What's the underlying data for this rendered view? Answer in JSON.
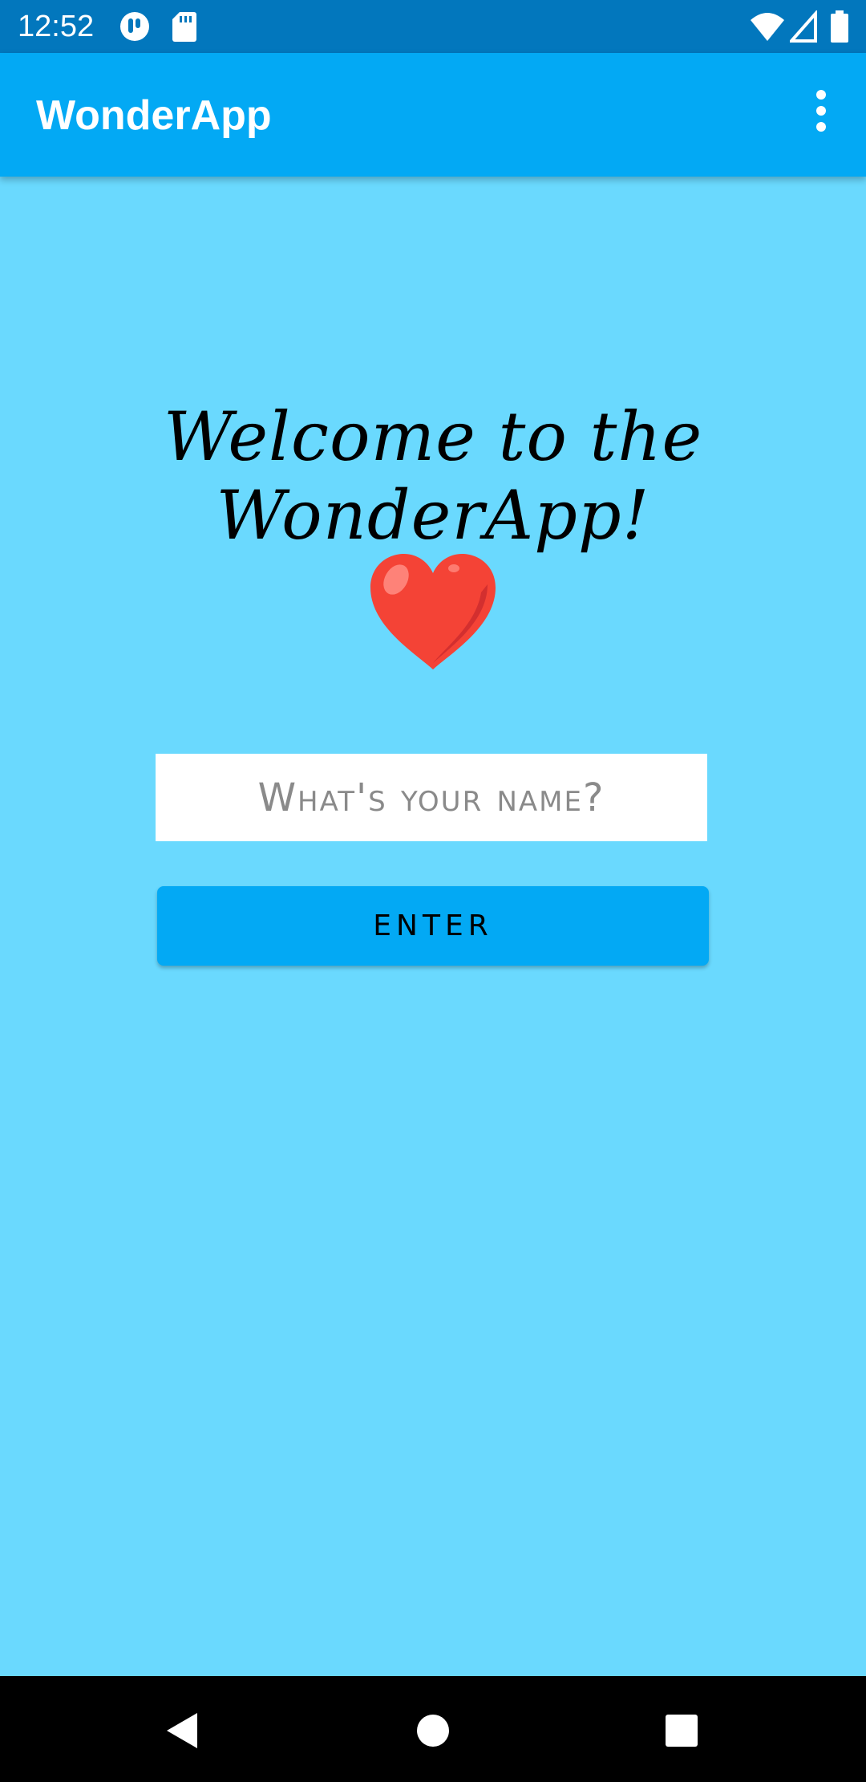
{
  "status_bar": {
    "time": "12:52",
    "icons": [
      "notification-app-icon",
      "sd-card-icon",
      "wifi-icon",
      "signal-icon",
      "battery-icon"
    ]
  },
  "app_bar": {
    "title": "WonderApp",
    "overflow_icon": "more-vert-icon"
  },
  "main": {
    "welcome_text": "Welcome to the WonderApp!",
    "heart_icon": "heart-icon",
    "name_input": {
      "placeholder": "What's your name?",
      "value": ""
    },
    "enter_label": "ENTER"
  },
  "nav_bar": {
    "icons": [
      "back-icon",
      "home-icon",
      "recents-icon"
    ]
  },
  "colors": {
    "background": "#6ad9fe",
    "app_bar": "#03a9f4",
    "status_bar": "#0277bd",
    "button": "#03a9f4",
    "heart": "#f44336"
  }
}
